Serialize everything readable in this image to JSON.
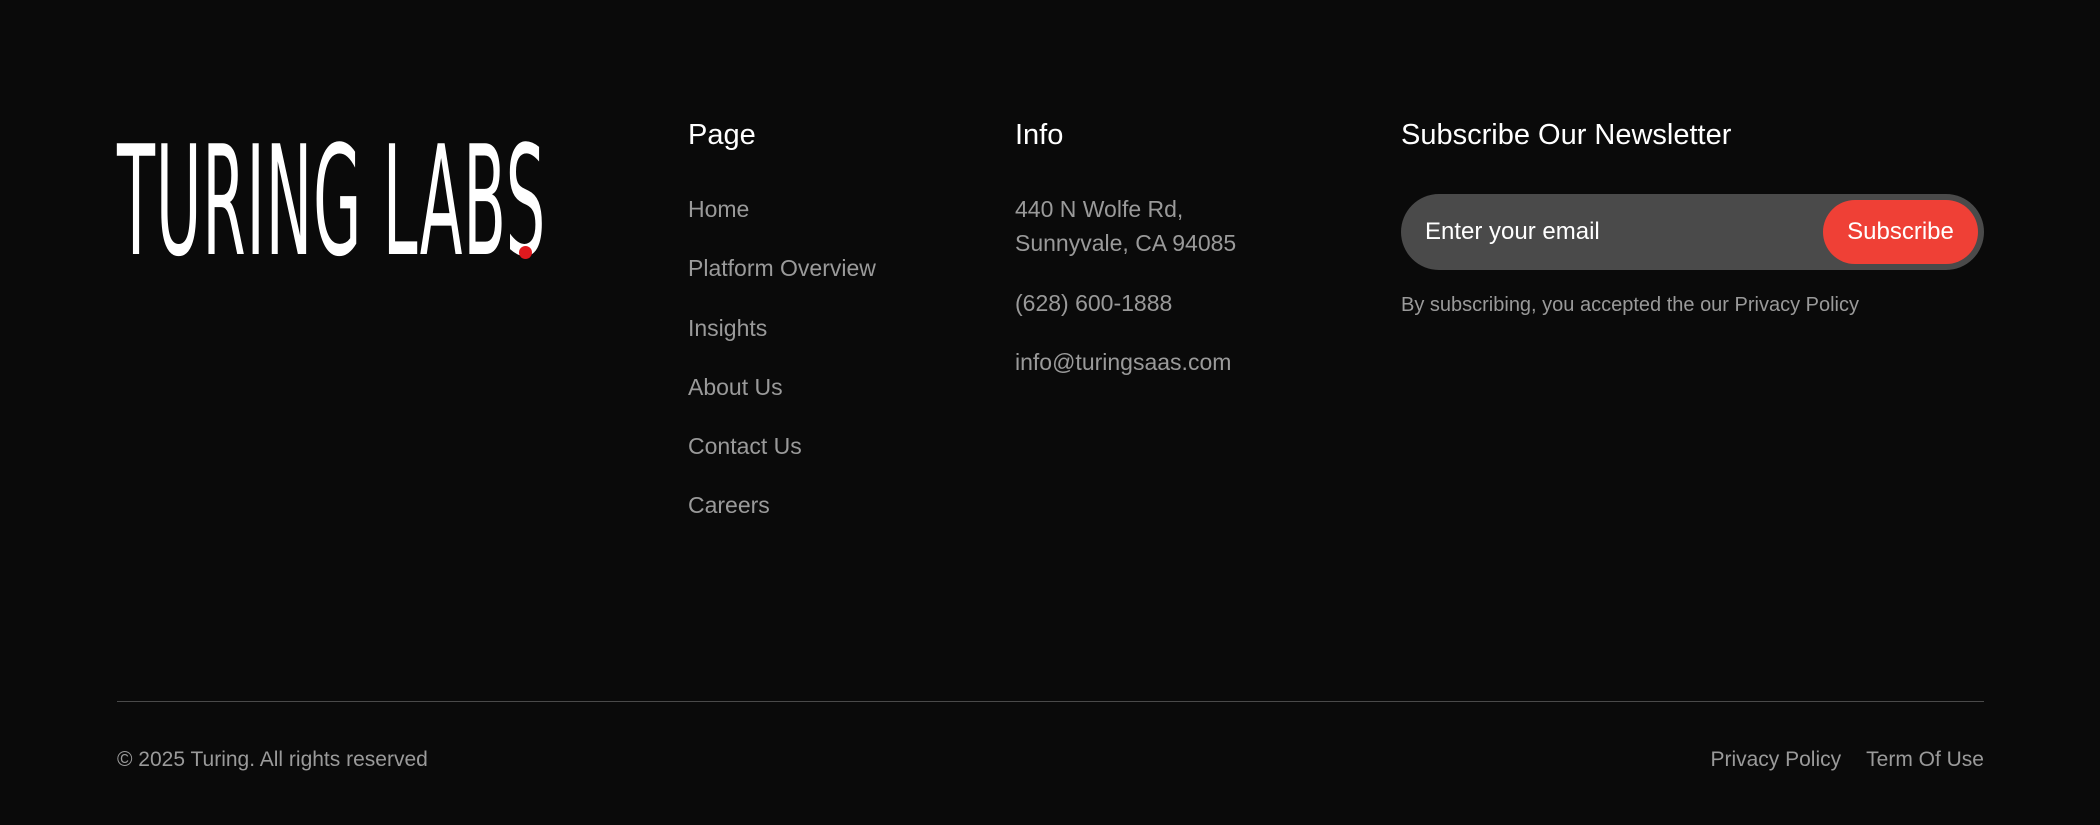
{
  "brand": {
    "logo_text": "TURING LABS",
    "accent_color": "#ef4036",
    "dot_color": "#e0191e"
  },
  "page_column": {
    "heading": "Page",
    "links": [
      "Home",
      "Platform Overview",
      "Insights",
      "About Us",
      "Contact Us",
      "Careers"
    ]
  },
  "info_column": {
    "heading": "Info",
    "address_line1": "440 N Wolfe Rd,",
    "address_line2": "Sunnyvale, CA 94085",
    "phone": "(628) 600-1888",
    "email": "info@turingsaas.com"
  },
  "newsletter": {
    "heading": "Subscribe Our Newsletter",
    "input_placeholder": "Enter your email",
    "button_label": "Subscribe",
    "note": "By subscribing, you accepted the our Privacy Policy"
  },
  "bottom_bar": {
    "copyright": "© 2025 Turing. All rights reserved",
    "links": [
      "Privacy Policy",
      "Term Of Use"
    ]
  }
}
